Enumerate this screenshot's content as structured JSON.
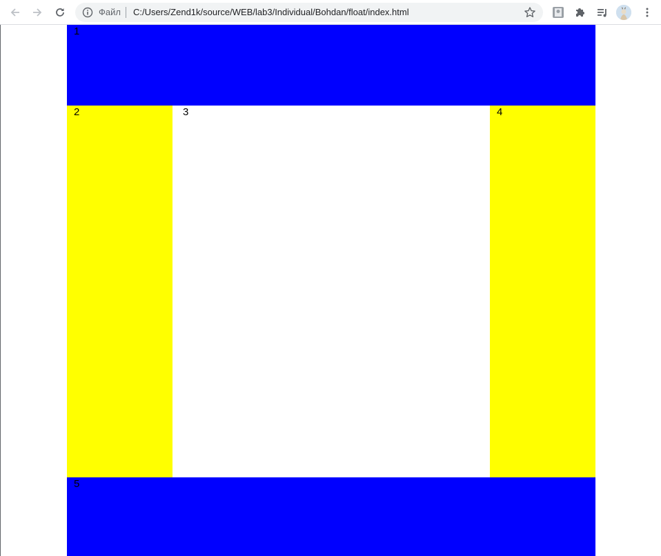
{
  "browser": {
    "omnibox": {
      "scheme_label": "Файл",
      "url": "C:/Users/Zend1k/source/WEB/lab3/Individual/Bohdan/float/index.html"
    },
    "icons": [
      "back-arrow-icon",
      "forward-arrow-icon",
      "reload-icon",
      "info-icon",
      "bookmark-star-icon",
      "extension-profile-icon",
      "puzzle-extensions-icon",
      "media-queue-icon",
      "avatar",
      "kebab-menu-icon"
    ]
  },
  "page": {
    "blocks": [
      {
        "label": "1",
        "color": "#0000ff"
      },
      {
        "label": "2",
        "color": "#ffff00"
      },
      {
        "label": "3",
        "color": "#ffffff"
      },
      {
        "label": "4",
        "color": "#ffff00"
      },
      {
        "label": "5",
        "color": "#0000ff"
      }
    ]
  }
}
